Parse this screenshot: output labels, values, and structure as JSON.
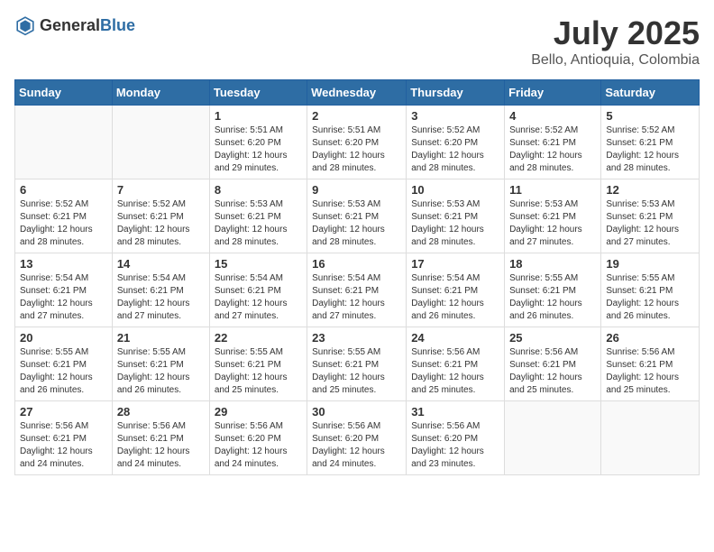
{
  "header": {
    "logo_general": "General",
    "logo_blue": "Blue",
    "month": "July 2025",
    "location": "Bello, Antioquia, Colombia"
  },
  "weekdays": [
    "Sunday",
    "Monday",
    "Tuesday",
    "Wednesday",
    "Thursday",
    "Friday",
    "Saturday"
  ],
  "weeks": [
    [
      {
        "day": "",
        "empty": true
      },
      {
        "day": "",
        "empty": true
      },
      {
        "day": "1",
        "sunrise": "Sunrise: 5:51 AM",
        "sunset": "Sunset: 6:20 PM",
        "daylight": "Daylight: 12 hours and 29 minutes."
      },
      {
        "day": "2",
        "sunrise": "Sunrise: 5:51 AM",
        "sunset": "Sunset: 6:20 PM",
        "daylight": "Daylight: 12 hours and 28 minutes."
      },
      {
        "day": "3",
        "sunrise": "Sunrise: 5:52 AM",
        "sunset": "Sunset: 6:20 PM",
        "daylight": "Daylight: 12 hours and 28 minutes."
      },
      {
        "day": "4",
        "sunrise": "Sunrise: 5:52 AM",
        "sunset": "Sunset: 6:21 PM",
        "daylight": "Daylight: 12 hours and 28 minutes."
      },
      {
        "day": "5",
        "sunrise": "Sunrise: 5:52 AM",
        "sunset": "Sunset: 6:21 PM",
        "daylight": "Daylight: 12 hours and 28 minutes."
      }
    ],
    [
      {
        "day": "6",
        "sunrise": "Sunrise: 5:52 AM",
        "sunset": "Sunset: 6:21 PM",
        "daylight": "Daylight: 12 hours and 28 minutes."
      },
      {
        "day": "7",
        "sunrise": "Sunrise: 5:52 AM",
        "sunset": "Sunset: 6:21 PM",
        "daylight": "Daylight: 12 hours and 28 minutes."
      },
      {
        "day": "8",
        "sunrise": "Sunrise: 5:53 AM",
        "sunset": "Sunset: 6:21 PM",
        "daylight": "Daylight: 12 hours and 28 minutes."
      },
      {
        "day": "9",
        "sunrise": "Sunrise: 5:53 AM",
        "sunset": "Sunset: 6:21 PM",
        "daylight": "Daylight: 12 hours and 28 minutes."
      },
      {
        "day": "10",
        "sunrise": "Sunrise: 5:53 AM",
        "sunset": "Sunset: 6:21 PM",
        "daylight": "Daylight: 12 hours and 28 minutes."
      },
      {
        "day": "11",
        "sunrise": "Sunrise: 5:53 AM",
        "sunset": "Sunset: 6:21 PM",
        "daylight": "Daylight: 12 hours and 27 minutes."
      },
      {
        "day": "12",
        "sunrise": "Sunrise: 5:53 AM",
        "sunset": "Sunset: 6:21 PM",
        "daylight": "Daylight: 12 hours and 27 minutes."
      }
    ],
    [
      {
        "day": "13",
        "sunrise": "Sunrise: 5:54 AM",
        "sunset": "Sunset: 6:21 PM",
        "daylight": "Daylight: 12 hours and 27 minutes."
      },
      {
        "day": "14",
        "sunrise": "Sunrise: 5:54 AM",
        "sunset": "Sunset: 6:21 PM",
        "daylight": "Daylight: 12 hours and 27 minutes."
      },
      {
        "day": "15",
        "sunrise": "Sunrise: 5:54 AM",
        "sunset": "Sunset: 6:21 PM",
        "daylight": "Daylight: 12 hours and 27 minutes."
      },
      {
        "day": "16",
        "sunrise": "Sunrise: 5:54 AM",
        "sunset": "Sunset: 6:21 PM",
        "daylight": "Daylight: 12 hours and 27 minutes."
      },
      {
        "day": "17",
        "sunrise": "Sunrise: 5:54 AM",
        "sunset": "Sunset: 6:21 PM",
        "daylight": "Daylight: 12 hours and 26 minutes."
      },
      {
        "day": "18",
        "sunrise": "Sunrise: 5:55 AM",
        "sunset": "Sunset: 6:21 PM",
        "daylight": "Daylight: 12 hours and 26 minutes."
      },
      {
        "day": "19",
        "sunrise": "Sunrise: 5:55 AM",
        "sunset": "Sunset: 6:21 PM",
        "daylight": "Daylight: 12 hours and 26 minutes."
      }
    ],
    [
      {
        "day": "20",
        "sunrise": "Sunrise: 5:55 AM",
        "sunset": "Sunset: 6:21 PM",
        "daylight": "Daylight: 12 hours and 26 minutes."
      },
      {
        "day": "21",
        "sunrise": "Sunrise: 5:55 AM",
        "sunset": "Sunset: 6:21 PM",
        "daylight": "Daylight: 12 hours and 26 minutes."
      },
      {
        "day": "22",
        "sunrise": "Sunrise: 5:55 AM",
        "sunset": "Sunset: 6:21 PM",
        "daylight": "Daylight: 12 hours and 25 minutes."
      },
      {
        "day": "23",
        "sunrise": "Sunrise: 5:55 AM",
        "sunset": "Sunset: 6:21 PM",
        "daylight": "Daylight: 12 hours and 25 minutes."
      },
      {
        "day": "24",
        "sunrise": "Sunrise: 5:56 AM",
        "sunset": "Sunset: 6:21 PM",
        "daylight": "Daylight: 12 hours and 25 minutes."
      },
      {
        "day": "25",
        "sunrise": "Sunrise: 5:56 AM",
        "sunset": "Sunset: 6:21 PM",
        "daylight": "Daylight: 12 hours and 25 minutes."
      },
      {
        "day": "26",
        "sunrise": "Sunrise: 5:56 AM",
        "sunset": "Sunset: 6:21 PM",
        "daylight": "Daylight: 12 hours and 25 minutes."
      }
    ],
    [
      {
        "day": "27",
        "sunrise": "Sunrise: 5:56 AM",
        "sunset": "Sunset: 6:21 PM",
        "daylight": "Daylight: 12 hours and 24 minutes."
      },
      {
        "day": "28",
        "sunrise": "Sunrise: 5:56 AM",
        "sunset": "Sunset: 6:21 PM",
        "daylight": "Daylight: 12 hours and 24 minutes."
      },
      {
        "day": "29",
        "sunrise": "Sunrise: 5:56 AM",
        "sunset": "Sunset: 6:20 PM",
        "daylight": "Daylight: 12 hours and 24 minutes."
      },
      {
        "day": "30",
        "sunrise": "Sunrise: 5:56 AM",
        "sunset": "Sunset: 6:20 PM",
        "daylight": "Daylight: 12 hours and 24 minutes."
      },
      {
        "day": "31",
        "sunrise": "Sunrise: 5:56 AM",
        "sunset": "Sunset: 6:20 PM",
        "daylight": "Daylight: 12 hours and 23 minutes."
      },
      {
        "day": "",
        "empty": true
      },
      {
        "day": "",
        "empty": true
      }
    ]
  ]
}
